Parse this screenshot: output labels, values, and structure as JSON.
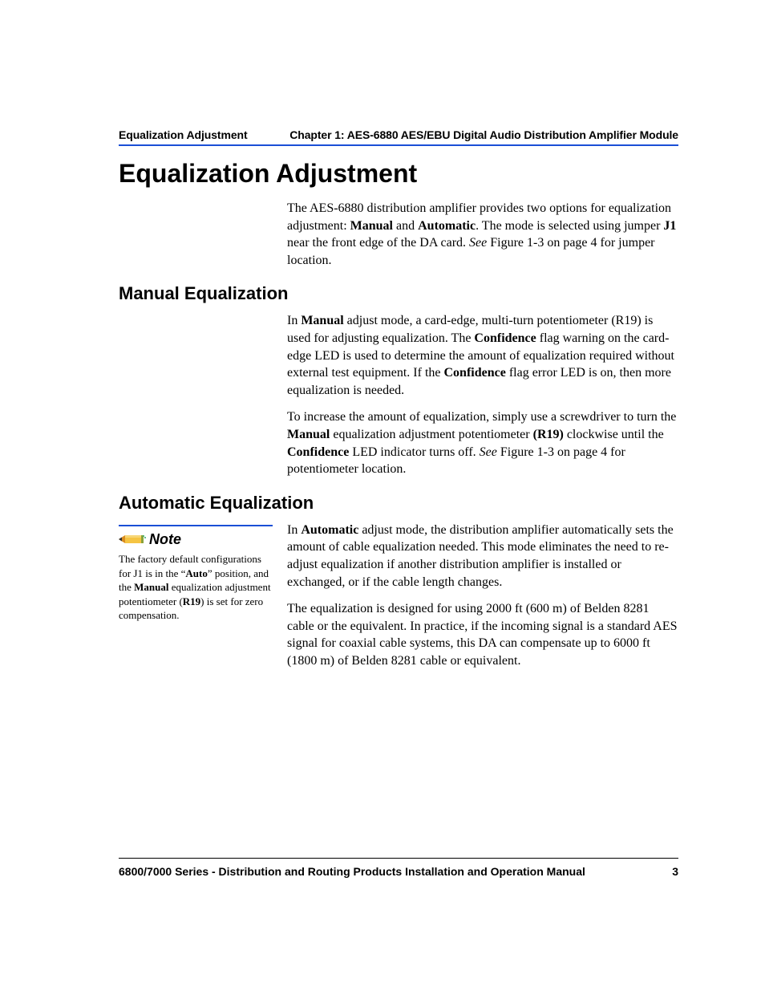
{
  "header": {
    "left": "Equalization Adjustment",
    "right": "Chapter 1: AES-6880 AES/EBU Digital Audio Distribution Amplifier Module"
  },
  "title": "Equalization Adjustment",
  "intro": {
    "pre": "The AES-6880 distribution amplifier provides two options for equalization adjustment: ",
    "b1": "Manual",
    "mid1": " and ",
    "b2": "Automatic",
    "mid2": ". The mode is selected using jumper ",
    "b3": "J1",
    "mid3": " near the front edge of the DA card. ",
    "i1": "See",
    "post": " Figure 1-3 on page 4 for jumper location."
  },
  "manual": {
    "heading": "Manual Equalization",
    "p1": {
      "a": "In ",
      "b1": "Manual",
      "b": " adjust mode, a card-edge, multi-turn potentiometer (R19) is used for adjusting equalization. The ",
      "b2": "Confidence",
      "c": " flag warning on the card-edge LED is used to determine the amount of equalization required without external test equipment. If the ",
      "b3": "Confidence",
      "d": " flag error LED is on, then more equalization is needed."
    },
    "p2": {
      "a": "To increase the amount of equalization, simply use a screwdriver to turn the ",
      "b1": "Manual",
      "b": " equalization adjustment potentiometer ",
      "b2": "(R19)",
      "c": " clockwise until the ",
      "b3": "Confidence",
      "d": " LED indicator turns off. ",
      "i1": "See",
      "e": " Figure 1-3 on page 4 for potentiometer location."
    }
  },
  "auto": {
    "heading": "Automatic Equalization",
    "note_label": "Note",
    "note": {
      "a": "The factory default configurations for J1 is in the “",
      "b1": "Auto",
      "b": "” position, and the ",
      "b2": "Manual",
      "c": " equalization adjustment potentiometer (",
      "b3": "R19",
      "d": ") is set for zero compensation."
    },
    "p1": {
      "a": "In ",
      "b1": "Automatic",
      "b": " adjust mode, the distribution amplifier automatically sets the amount of cable equalization needed. This mode eliminates the need to re-adjust equalization if another distribution amplifier is installed or exchanged, or if the cable length changes."
    },
    "p2": "The equalization is designed for using 2000 ft (600 m) of Belden 8281 cable or the equivalent. In practice, if the incoming signal is a standard AES signal for coaxial cable systems, this DA can compensate up to 6000 ft (1800 m) of Belden 8281 cable or equivalent."
  },
  "footer": {
    "left": "6800/7000 Series - Distribution and Routing Products Installation and Operation Manual",
    "page": "3"
  }
}
